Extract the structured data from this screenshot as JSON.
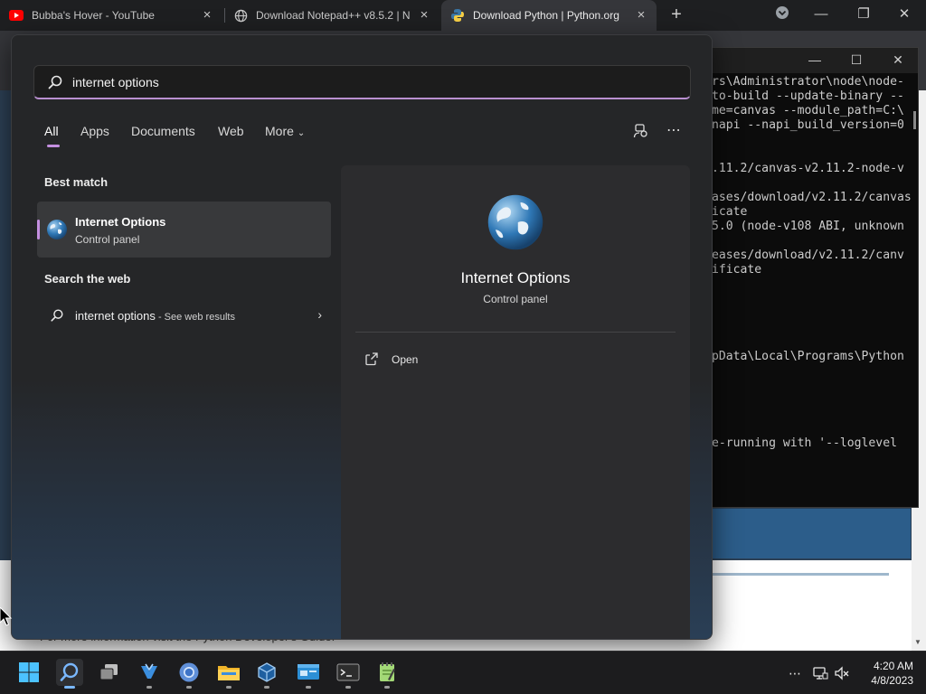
{
  "browser": {
    "tabs": [
      {
        "title": "Bubba's Hover - YouTube",
        "icon": "youtube-icon"
      },
      {
        "title": "Download Notepad++ v8.5.2 | N",
        "icon": "globe-icon"
      },
      {
        "title": "Download Python | Python.org",
        "icon": "python-icon"
      }
    ],
    "page_footer_text": "For more information visit the Python Developer's Guide."
  },
  "terminal": {
    "lines": [
      "rs\\Administrator\\node\\node-",
      "to-build --update-binary --",
      "me=canvas --module_path=C:\\",
      "napi --napi_build_version=0",
      "",
      "",
      ".11.2/canvas-v2.11.2-node-v",
      "",
      "ases/download/v2.11.2/canvas",
      "icate",
      "5.0 (node-v108 ABI, unknown",
      "",
      "eases/download/v2.11.2/canv",
      "ificate",
      "",
      "",
      "",
      "",
      "",
      "pData\\Local\\Programs\\Python",
      "",
      "",
      "",
      "",
      "",
      "e-running with '--loglevel"
    ]
  },
  "search": {
    "query": "internet options",
    "tabs": [
      "All",
      "Apps",
      "Documents",
      "Web",
      "More"
    ],
    "best_match_heading": "Best match",
    "best_match": {
      "title": "Internet Options",
      "subtitle": "Control panel"
    },
    "web_heading": "Search the web",
    "web_result": {
      "query": "internet options",
      "suffix": " - See web results"
    },
    "detail": {
      "title": "Internet Options",
      "subtitle": "Control panel",
      "open_label": "Open"
    }
  },
  "taskbar": {
    "apps": [
      "start-icon",
      "search-icon",
      "task-view-icon",
      "app-icon",
      "chrome-icon",
      "file-explorer-icon",
      "virtualbox-icon",
      "app-window-icon",
      "terminal-icon",
      "notepadpp-icon"
    ],
    "time": "4:20 AM",
    "date": "4/8/2023"
  },
  "colors": {
    "accent": "#c48fe0",
    "flyout_bg": "#252628",
    "taskbar_bg": "#1c1c1e"
  }
}
